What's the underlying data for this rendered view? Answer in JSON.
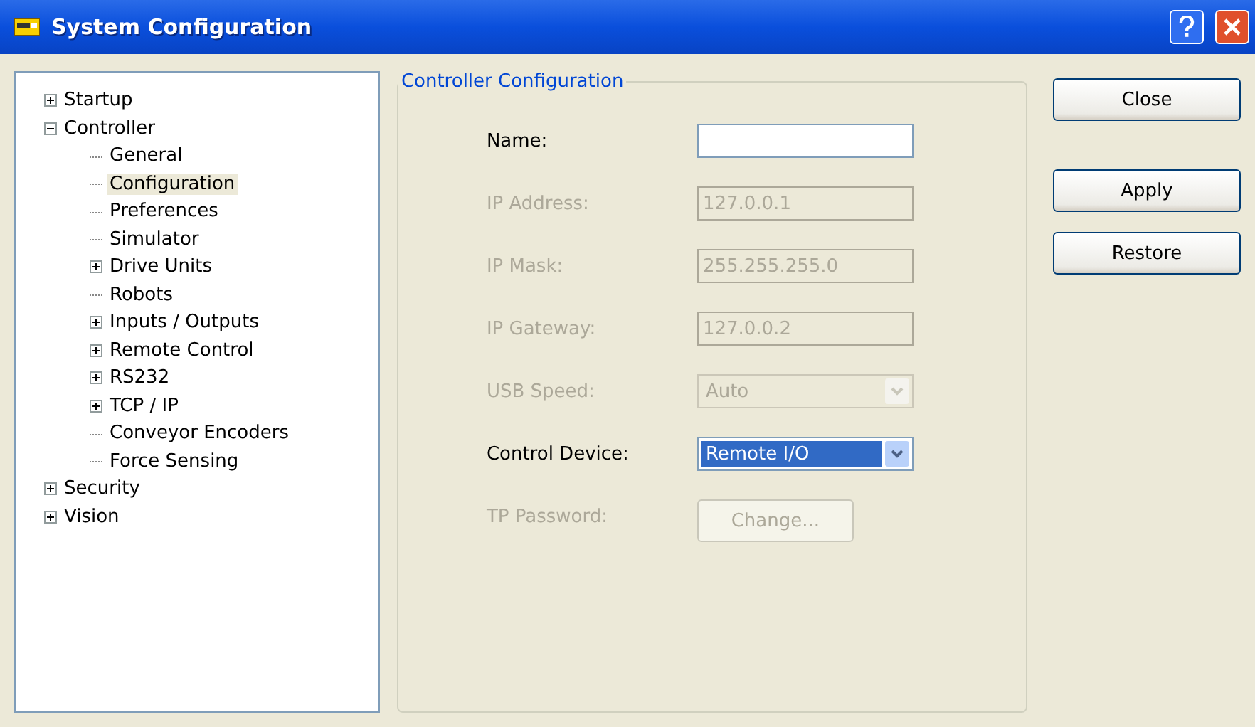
{
  "window": {
    "title": "System Configuration"
  },
  "tree": [
    {
      "label": "Startup",
      "expanded": false,
      "selected": false
    },
    {
      "label": "Controller",
      "expanded": true,
      "selected": false,
      "children": [
        {
          "label": "General",
          "selected": false
        },
        {
          "label": "Configuration",
          "selected": true
        },
        {
          "label": "Preferences",
          "selected": false
        },
        {
          "label": "Simulator",
          "selected": false
        },
        {
          "label": "Drive Units",
          "selected": false,
          "expanded": false
        },
        {
          "label": "Robots",
          "selected": false
        },
        {
          "label": "Inputs / Outputs",
          "selected": false,
          "expanded": false
        },
        {
          "label": "Remote Control",
          "selected": false,
          "expanded": false
        },
        {
          "label": "RS232",
          "selected": false,
          "expanded": false
        },
        {
          "label": "TCP / IP",
          "selected": false,
          "expanded": false
        },
        {
          "label": "Conveyor Encoders",
          "selected": false
        },
        {
          "label": "Force Sensing",
          "selected": false
        }
      ]
    },
    {
      "label": "Security",
      "expanded": false,
      "selected": false
    },
    {
      "label": "Vision",
      "expanded": false,
      "selected": false
    }
  ],
  "group": {
    "title": "Controller Configuration",
    "rows": [
      {
        "kind": "text",
        "label": "Name:",
        "value": "",
        "disabled": false
      },
      {
        "kind": "text",
        "label": "IP Address:",
        "value": "127.0.0.1",
        "disabled": true
      },
      {
        "kind": "text",
        "label": "IP Mask:",
        "value": "255.255.255.0",
        "disabled": true
      },
      {
        "kind": "text",
        "label": "IP Gateway:",
        "value": "127.0.0.2",
        "disabled": true
      },
      {
        "kind": "combo",
        "label": "USB Speed:",
        "value": "Auto",
        "disabled": true
      },
      {
        "kind": "combo",
        "label": "Control Device:",
        "value": "Remote I/O",
        "disabled": false
      },
      {
        "kind": "button",
        "label": "TP Password:",
        "value": "Change...",
        "disabled": true
      }
    ]
  },
  "buttons": [
    "Close",
    "Apply",
    "Restore"
  ]
}
